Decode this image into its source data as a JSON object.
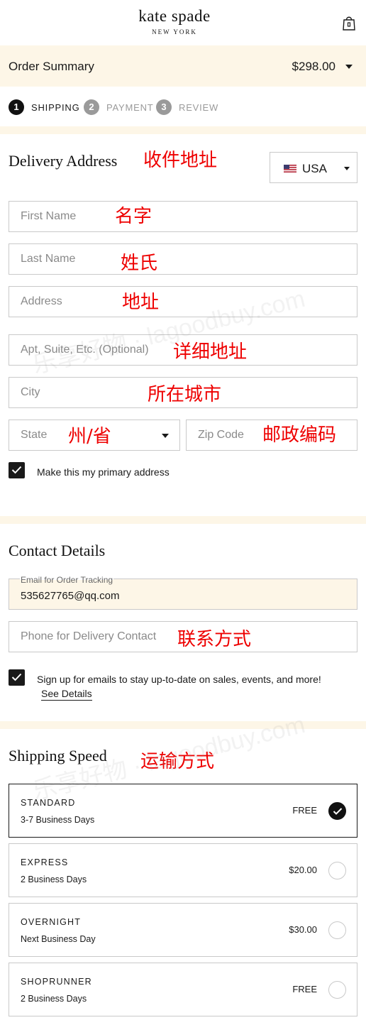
{
  "header": {
    "brand": "kate spade",
    "brand_sub": "NEW YORK",
    "bag_icon": "shopping-bag-icon"
  },
  "order_summary": {
    "title": "Order Summary",
    "total": "$298.00",
    "caret_icon": "chevron-down-icon"
  },
  "steps": [
    {
      "number": "1",
      "label": "SHIPPING",
      "active": true
    },
    {
      "number": "2",
      "label": "PAYMENT",
      "active": false
    },
    {
      "number": "3",
      "label": "REVIEW",
      "active": false
    }
  ],
  "delivery": {
    "title": "Delivery Address",
    "annotation": "收件地址",
    "country": {
      "value": "USA",
      "flag_icon": "us-flag-icon"
    },
    "fields": [
      {
        "placeholder": "First Name",
        "annotation": "名字"
      },
      {
        "placeholder": "Last Name",
        "annotation": "姓氏"
      },
      {
        "placeholder": "Address",
        "annotation": "地址"
      },
      {
        "placeholder": "Apt, Suite, Etc. (Optional)",
        "annotation": "详细地址"
      },
      {
        "placeholder": "City",
        "annotation": "所在城市"
      },
      {
        "placeholder": "State",
        "annotation": "州/省"
      },
      {
        "placeholder": "Zip Code",
        "annotation": "邮政编码"
      }
    ],
    "primary_checkbox": {
      "label": "Make this my primary address",
      "checked": true
    }
  },
  "contact": {
    "title": "Contact Details",
    "email": {
      "label": "Email for Order Tracking",
      "value": "535627765@qq.com"
    },
    "phone": {
      "placeholder": "Phone for Delivery Contact",
      "annotation": "联系方式"
    },
    "signup": {
      "label": "Sign up for emails to stay up-to-date on sales, events, and more!",
      "link": "See Details",
      "checked": true
    }
  },
  "shipping": {
    "title": "Shipping Speed",
    "annotation": "运输方式",
    "options": [
      {
        "name": "STANDARD",
        "days": "3-7 Business Days",
        "price": "FREE",
        "selected": true
      },
      {
        "name": "EXPRESS",
        "days": "2 Business Days",
        "price": "$20.00",
        "selected": false
      },
      {
        "name": "OVERNIGHT",
        "days": "Next Business Day",
        "price": "$30.00",
        "selected": false
      },
      {
        "name": "SHOPRUNNER",
        "days": "2 Business Days",
        "price": "FREE",
        "selected": false
      }
    ]
  },
  "watermark": {
    "text": "乐享好物 · lagoodbuy.com"
  },
  "colors": {
    "band": "#fdf6e7",
    "border": "#c9c9c9",
    "text": "#1a1a1a",
    "inactive_step": "#9a9a9a",
    "annotation": "#ee0000"
  }
}
